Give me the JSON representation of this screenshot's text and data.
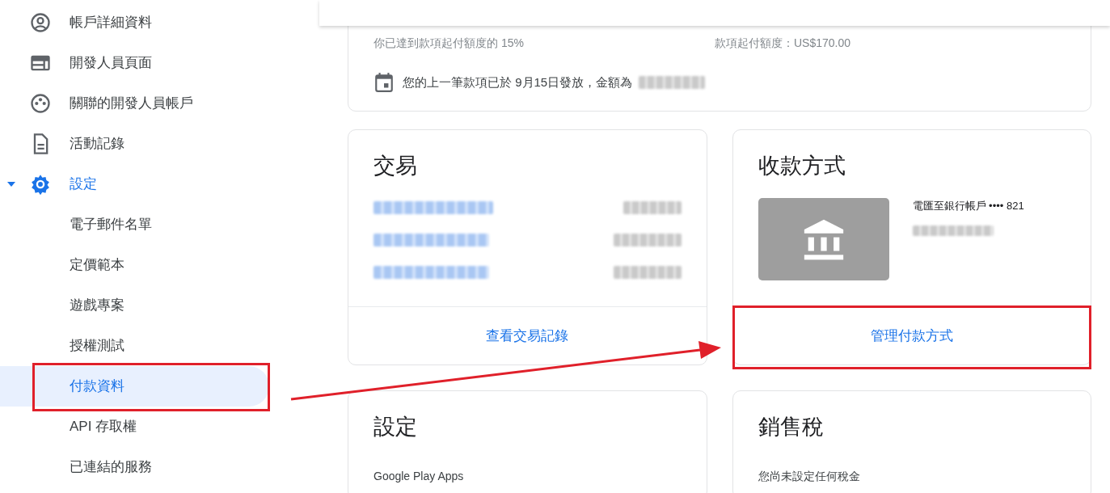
{
  "sidebar": {
    "items": [
      {
        "label": "帳戶詳細資料",
        "selected": false
      },
      {
        "label": "開發人員頁面",
        "selected": false
      },
      {
        "label": "關聯的開發人員帳戶",
        "selected": false
      },
      {
        "label": "活動記錄",
        "selected": false
      },
      {
        "label": "設定",
        "selected": false,
        "expanded": true,
        "children": [
          {
            "label": "電子郵件名單",
            "selected": false
          },
          {
            "label": "定價範本",
            "selected": false
          },
          {
            "label": "遊戲專案",
            "selected": false
          },
          {
            "label": "授權測試",
            "selected": false
          },
          {
            "label": "付款資料",
            "selected": true
          },
          {
            "label": "API 存取權",
            "selected": false
          },
          {
            "label": "已連結的服務",
            "selected": false
          }
        ]
      }
    ]
  },
  "summary": {
    "progress_text": "你已達到款項起付額度的 15%",
    "threshold_text": "款項起付額度：US$170.00",
    "last_payment": "您的上一筆款項已於 9月15日發放，金額為"
  },
  "transactions": {
    "title": "交易",
    "link": "查看交易記錄"
  },
  "payment_methods": {
    "title": "收款方式",
    "account": "電匯至銀行帳戶 •••• 821",
    "link": "管理付款方式"
  },
  "settings_card": {
    "title": "設定",
    "text": "Google Play Apps"
  },
  "sales_tax": {
    "title": "銷售稅",
    "text": "您尚未設定任何稅金"
  }
}
